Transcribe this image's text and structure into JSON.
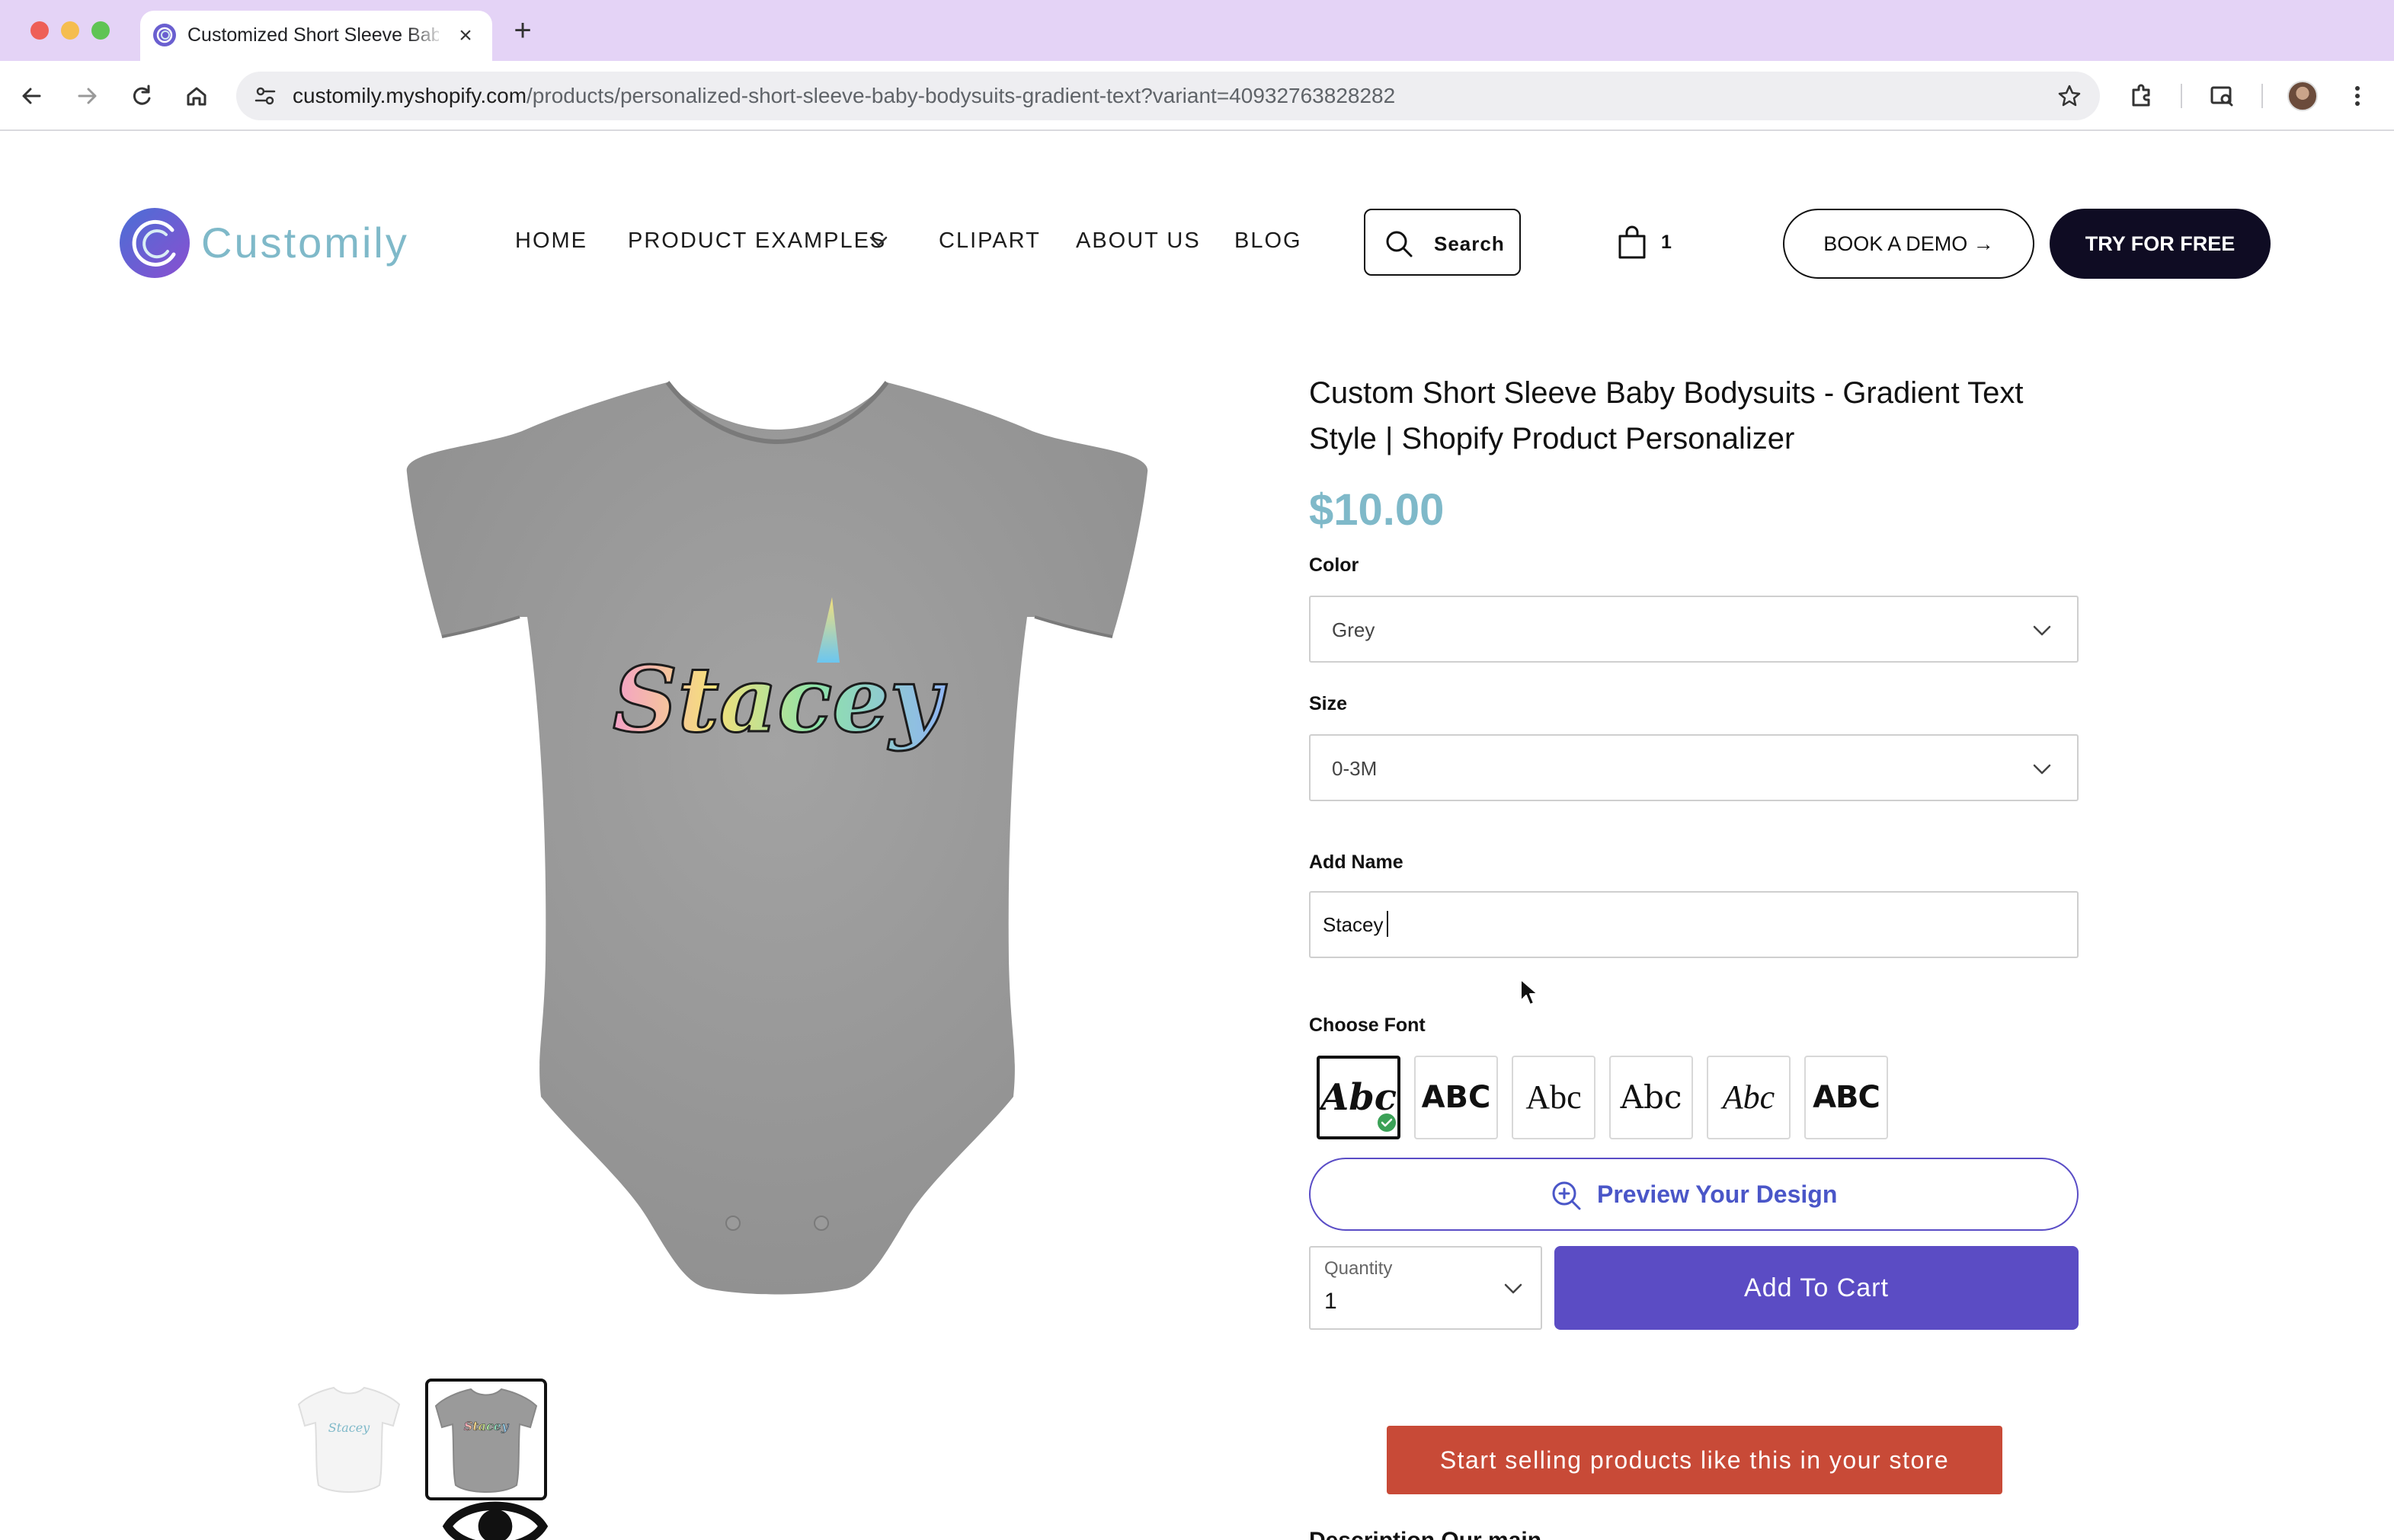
{
  "browser": {
    "tab_title": "Customized Short Sleeve Bab",
    "url_host": "customily.myshopify.com",
    "url_path": "/products/personalized-short-sleeve-baby-bodysuits-gradient-text?variant=40932763828282"
  },
  "header": {
    "logo_text": "Customily",
    "nav": {
      "home": "HOME",
      "product_examples": "PRODUCT EXAMPLES",
      "clipart": "CLIPART",
      "about": "ABOUT US",
      "blog": "BLOG"
    },
    "search_label": "Search",
    "cart_count": "1",
    "book_demo": "BOOK A DEMO →",
    "try_free": "TRY FOR FREE"
  },
  "product": {
    "title_line1": "Custom Short Sleeve Baby Bodysuits - Gradient Text",
    "title_line2": "Style | Shopify Product Personalizer",
    "price": "$10.00",
    "color_label": "Color",
    "color_value": "Grey",
    "size_label": "Size",
    "size_value": "0-3M",
    "name_label": "Add Name",
    "name_value": "Stacey",
    "font_label": "Choose Font",
    "fonts": [
      "Abc",
      "ABC",
      "Abc",
      "Abc",
      "Abc",
      "ABC"
    ],
    "preview_label": "Preview Your Design",
    "quantity_label": "Quantity",
    "quantity_value": "1",
    "add_to_cart": "Add To Cart",
    "sell_cta": "Start selling products like this in your store",
    "image_text": "Stacey",
    "thumb_text": "Stacey",
    "cut_off_text": "Description  Our main design"
  },
  "colors": {
    "accent": "#5b4cc4",
    "price": "#7fb9c9",
    "cta_red": "#c84a37",
    "dark": "#0f0c23",
    "tabbar": "#e4d3f6"
  }
}
